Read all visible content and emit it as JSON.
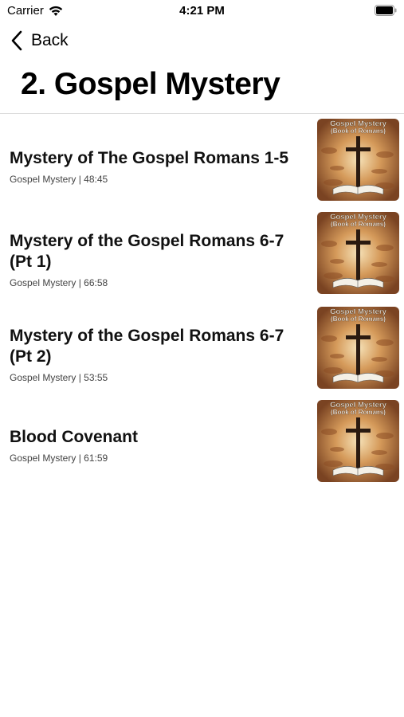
{
  "status_bar": {
    "carrier": "Carrier",
    "time": "4:21 PM"
  },
  "nav": {
    "back_label": "Back"
  },
  "page": {
    "title": "2. Gospel Mystery"
  },
  "episodes": [
    {
      "title": "Mystery of The Gospel Romans 1-5",
      "meta": "Gospel Mystery | 48:45",
      "artwork_line1": "Gospel Mystery",
      "artwork_line2": "(Book of Romans)"
    },
    {
      "title": "Mystery of the Gospel Romans 6-7 (Pt 1)",
      "meta": "Gospel Mystery | 66:58",
      "artwork_line1": "Gospel Mystery",
      "artwork_line2": "(Book of Romans)"
    },
    {
      "title": "Mystery of the Gospel Romans 6-7 (Pt 2)",
      "meta": "Gospel Mystery | 53:55",
      "artwork_line1": "Gospel Mystery",
      "artwork_line2": "(Book of Romans)"
    },
    {
      "title": "Blood Covenant",
      "meta": "Gospel Mystery | 61:59",
      "artwork_line1": "Gospel Mystery",
      "artwork_line2": "(Book of Romans)"
    }
  ],
  "icons": {
    "wifi": "wifi-icon",
    "battery": "battery-icon",
    "back": "chevron-left-icon",
    "artwork": "cross-bible-artwork"
  },
  "colors": {
    "artwork_bg": "#b8753a",
    "artwork_light": "#f1d6a8",
    "cross": "#2a1a10"
  }
}
